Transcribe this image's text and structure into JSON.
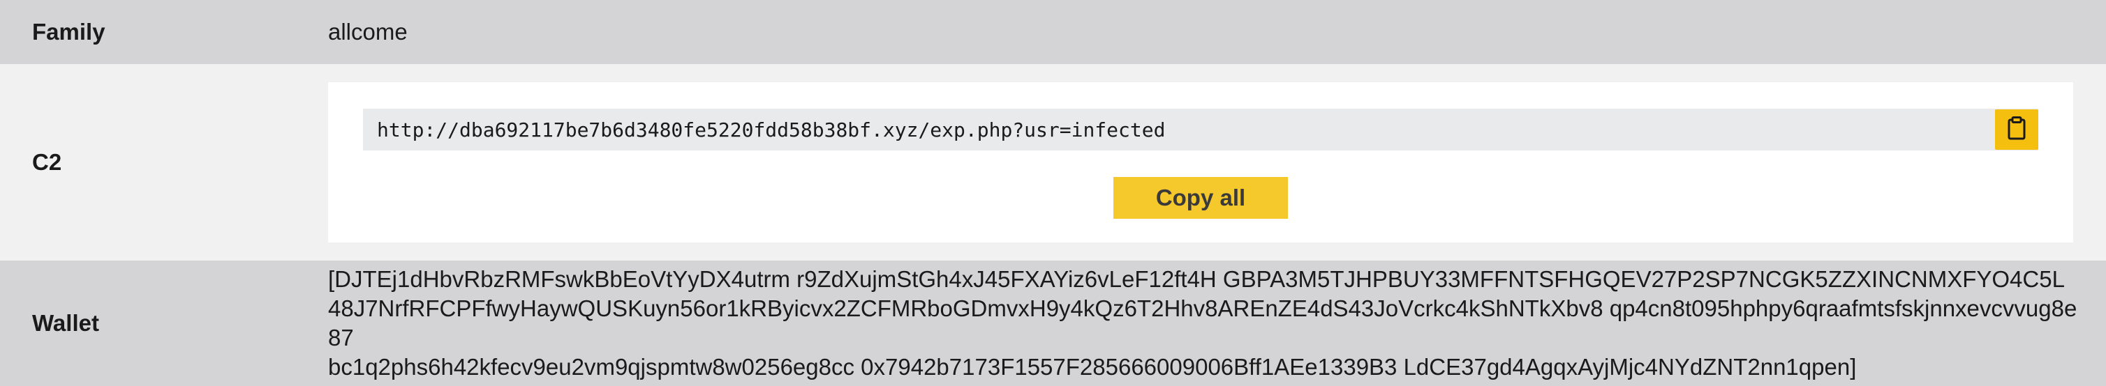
{
  "rows": {
    "family": {
      "label": "Family",
      "value": "allcome"
    },
    "c2": {
      "label": "C2",
      "url": "http://dba692117be7b6d3480fe5220fdd58b38bf.xyz/exp.php?usr=infected",
      "copy_all_label": "Copy all",
      "copy_icon": "clipboard-icon"
    },
    "wallet": {
      "label": "Wallet",
      "lines": [
        "[DJTEj1dHbvRbzRMFswkBbEoVtYyDX4utrm r9ZdXujmStGh4xJ45FXAYiz6vLeF12ft4H GBPA3M5TJHPBUY33MFFNTSFHGQEV27P2SP7NCGK5ZZXINCNMXFYO4C5L",
        "48J7NrfRFCPFfwyHaywQUSKuyn56or1kRByicvx2ZCFMRboGDmvxH9y4kQz6T2Hhv8AREnZE4dS43JoVcrkc4kShNTkXbv8 qp4cn8t095hphpy6qraafmtsfskjnnxevcvvug8e87",
        "bc1q2phs6h42kfecv9eu2vm9qjspmtw8w0256eg8cc 0x7942b7173F1557F285666009006Bff1AEe1339B3 LdCE37gd4AgqxAyjMjc4NYdZNT2nn1qpen]"
      ]
    }
  },
  "colors": {
    "row_dark": "#d4d4d6",
    "row_light": "#f1f1f2",
    "accent": "#f5bf10",
    "code_bg": "#e9eaec"
  }
}
